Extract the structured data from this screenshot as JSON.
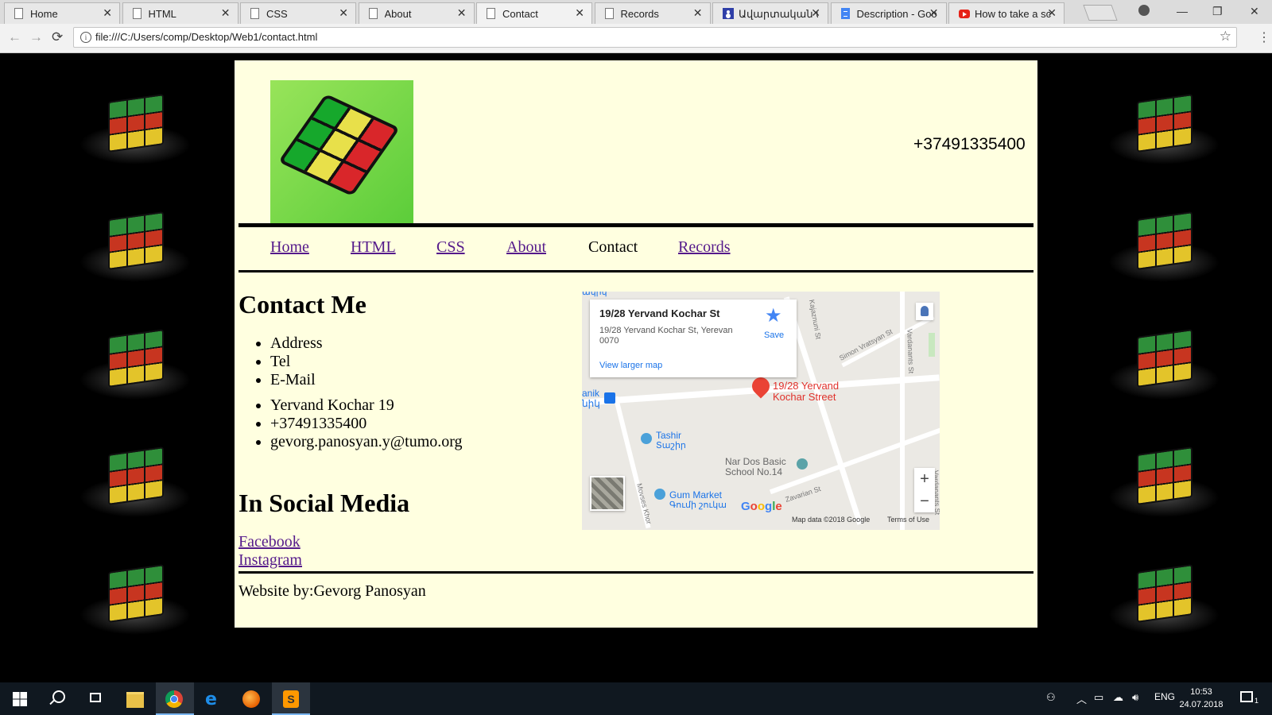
{
  "browser": {
    "tabs": [
      {
        "label": "Home",
        "icon": "page-icon",
        "active": false
      },
      {
        "label": "HTML",
        "icon": "page-icon",
        "active": false
      },
      {
        "label": "CSS",
        "icon": "page-icon",
        "active": false
      },
      {
        "label": "About",
        "icon": "page-icon",
        "active": false
      },
      {
        "label": "Contact",
        "icon": "page-icon",
        "active": true
      },
      {
        "label": "Records",
        "icon": "page-icon",
        "active": false
      },
      {
        "label": "Ավարտական ա",
        "icon": "contacts-icon",
        "active": false
      },
      {
        "label": "Description - Goo",
        "icon": "google-docs-icon",
        "active": false
      },
      {
        "label": "How to take a sc",
        "icon": "youtube-icon",
        "active": false
      }
    ],
    "tab_close_glyph": "✕",
    "url": "file:///C:/Users/comp/Desktop/Web1/contact.html"
  },
  "site": {
    "phone": "+37491335400",
    "nav": [
      {
        "label": "Home",
        "current": false
      },
      {
        "label": "HTML",
        "current": false
      },
      {
        "label": "CSS",
        "current": false
      },
      {
        "label": "About",
        "current": false
      },
      {
        "label": "Contact",
        "current": true
      },
      {
        "label": "Records",
        "current": false
      }
    ],
    "contact_heading": "Contact Me",
    "contact_labels": [
      "Address",
      "Tel",
      "E-Mail"
    ],
    "contact_values": [
      "Yervand Kochar 19",
      "+37491335400",
      "gevorg.panosyan.y@tumo.org"
    ],
    "social_heading": "In Social Media",
    "social_links": [
      "Facebook",
      "Instagram"
    ],
    "footer": "Website by:Gevorg Panosyan"
  },
  "map": {
    "place_title": "19/28 Yervand Kochar St",
    "place_address": "19/28 Yervand Kochar St, Yerevan 0070",
    "larger_map_link": "View larger map",
    "save_label": "Save",
    "pin_label": "19/28 Yervand Kochar Street",
    "pois": {
      "tashir": "Tashir",
      "tashir_local": "Տաշիր",
      "school": "Nar Dos Basic School No.14",
      "gum_market": "Gum Market",
      "gum_market_local": "Գումի շուկա",
      "metro": "anik",
      "metro_local": "նիկ",
      "top_fragment": "ակիկ"
    },
    "streets": {
      "kajaznuni": "Kajaznuni St",
      "vratsyan": "Simon Vratsyan St",
      "vardanants": "Vardanants St",
      "zavarian": "Zavarian St",
      "khorenatsi": "Movses Khor",
      "vardanants_bottom": "Vardanants St"
    },
    "zoom_in": "+",
    "zoom_out": "−",
    "logo": "Google",
    "attribution": "Map data ©2018 Google",
    "terms": "Terms of Use"
  },
  "taskbar": {
    "lang": "ENG",
    "time": "10:53",
    "date": "24.07.2018",
    "notifications": "1"
  }
}
